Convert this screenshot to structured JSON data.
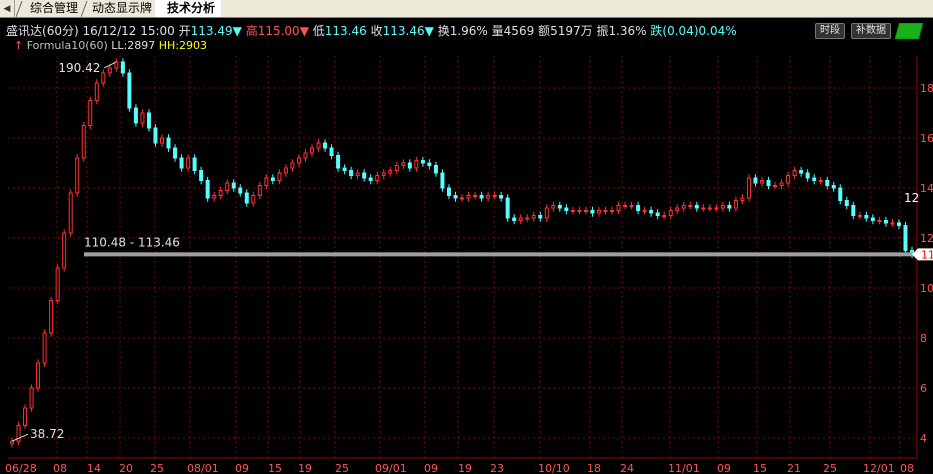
{
  "tabs": [
    {
      "label": "综合管理"
    },
    {
      "label": "动态显示牌"
    },
    {
      "label": "技术分析",
      "selected": true
    }
  ],
  "stock": {
    "name": "盛讯达",
    "period": "(60分)",
    "datetime": "16/12/12 15:00",
    "open_label": "开",
    "open": "113.49",
    "high_label": "高",
    "high": "115.00",
    "low_label": "低",
    "low": "113.46",
    "close_label": "收",
    "close": "113.46",
    "turnover_label": "换",
    "turnover": "1.96%",
    "volume_label": "量",
    "volume": "4569",
    "amount_label": "额",
    "amount": "5197万",
    "amplitude_label": "振",
    "amplitude": "1.36%",
    "change_label": "跌",
    "change": "(0.04)0.04%"
  },
  "formula": {
    "name": "Formula10(60)",
    "ll_label": "LL:",
    "ll": "2897",
    "hh_label": "HH:",
    "hh": "2903"
  },
  "buttons": {
    "timeseg": "时段",
    "fill": "补数据"
  },
  "annotations": {
    "high_mark": "190.42",
    "low_mark": "38.72",
    "range_line": "110.48 - 113.46",
    "right_marker_top": "12",
    "right_marker_current": "11"
  },
  "axis": {
    "y_ticks": [
      "18",
      "16",
      "14",
      "12",
      "10",
      "8",
      "6",
      "4"
    ],
    "x_ticks": [
      "06/28",
      "08",
      "14",
      "20",
      "25",
      "08/01",
      "09",
      "15",
      "19",
      "25",
      "09/01",
      "09",
      "19",
      "23",
      "10/10",
      "18",
      "24",
      "11/01",
      "09",
      "15",
      "21",
      "25",
      "12/01",
      "08"
    ]
  },
  "colors": {
    "up": "#ff3232",
    "down": "#54ffff",
    "grid": "#8b0000",
    "range_line": "#a0a0a0",
    "background": "#000000"
  },
  "chart_data": {
    "type": "candlestick",
    "title": "",
    "series": [
      {
        "values": [
          38.72,
          45,
          52,
          60,
          70,
          82,
          95,
          108,
          122,
          138,
          152,
          165,
          175,
          182,
          186,
          188,
          190.42,
          186,
          172,
          166,
          170,
          164,
          158,
          160,
          156,
          152,
          148,
          152,
          147,
          143,
          136,
          137,
          139,
          142,
          140,
          138,
          134,
          137,
          141,
          144,
          143,
          146,
          148,
          150,
          152,
          154,
          156,
          158,
          156,
          153,
          148,
          147,
          145,
          146,
          144,
          143,
          145,
          146,
          147,
          149,
          150,
          148,
          151,
          150,
          149,
          146,
          140,
          137,
          136,
          136,
          137,
          137,
          136,
          137,
          137,
          136,
          128,
          127,
          128,
          128,
          129,
          128,
          132,
          133,
          132,
          131,
          131,
          131,
          131,
          130,
          131,
          131,
          131,
          133,
          133,
          133,
          131,
          131,
          130,
          129,
          129,
          131,
          132,
          133,
          133,
          132,
          132,
          132,
          132,
          133,
          132,
          135,
          136,
          144,
          142,
          143,
          141,
          141,
          142,
          145,
          147,
          146,
          144,
          143,
          143,
          141,
          140,
          135,
          133,
          129,
          129,
          128,
          127,
          127,
          126,
          126,
          125,
          115,
          113.46
        ]
      }
    ],
    "high": 190.42,
    "low": 38.72,
    "horizontal_range": [
      110.48,
      113.46
    ],
    "ylim": [
      38,
      190
    ],
    "grid": true
  }
}
